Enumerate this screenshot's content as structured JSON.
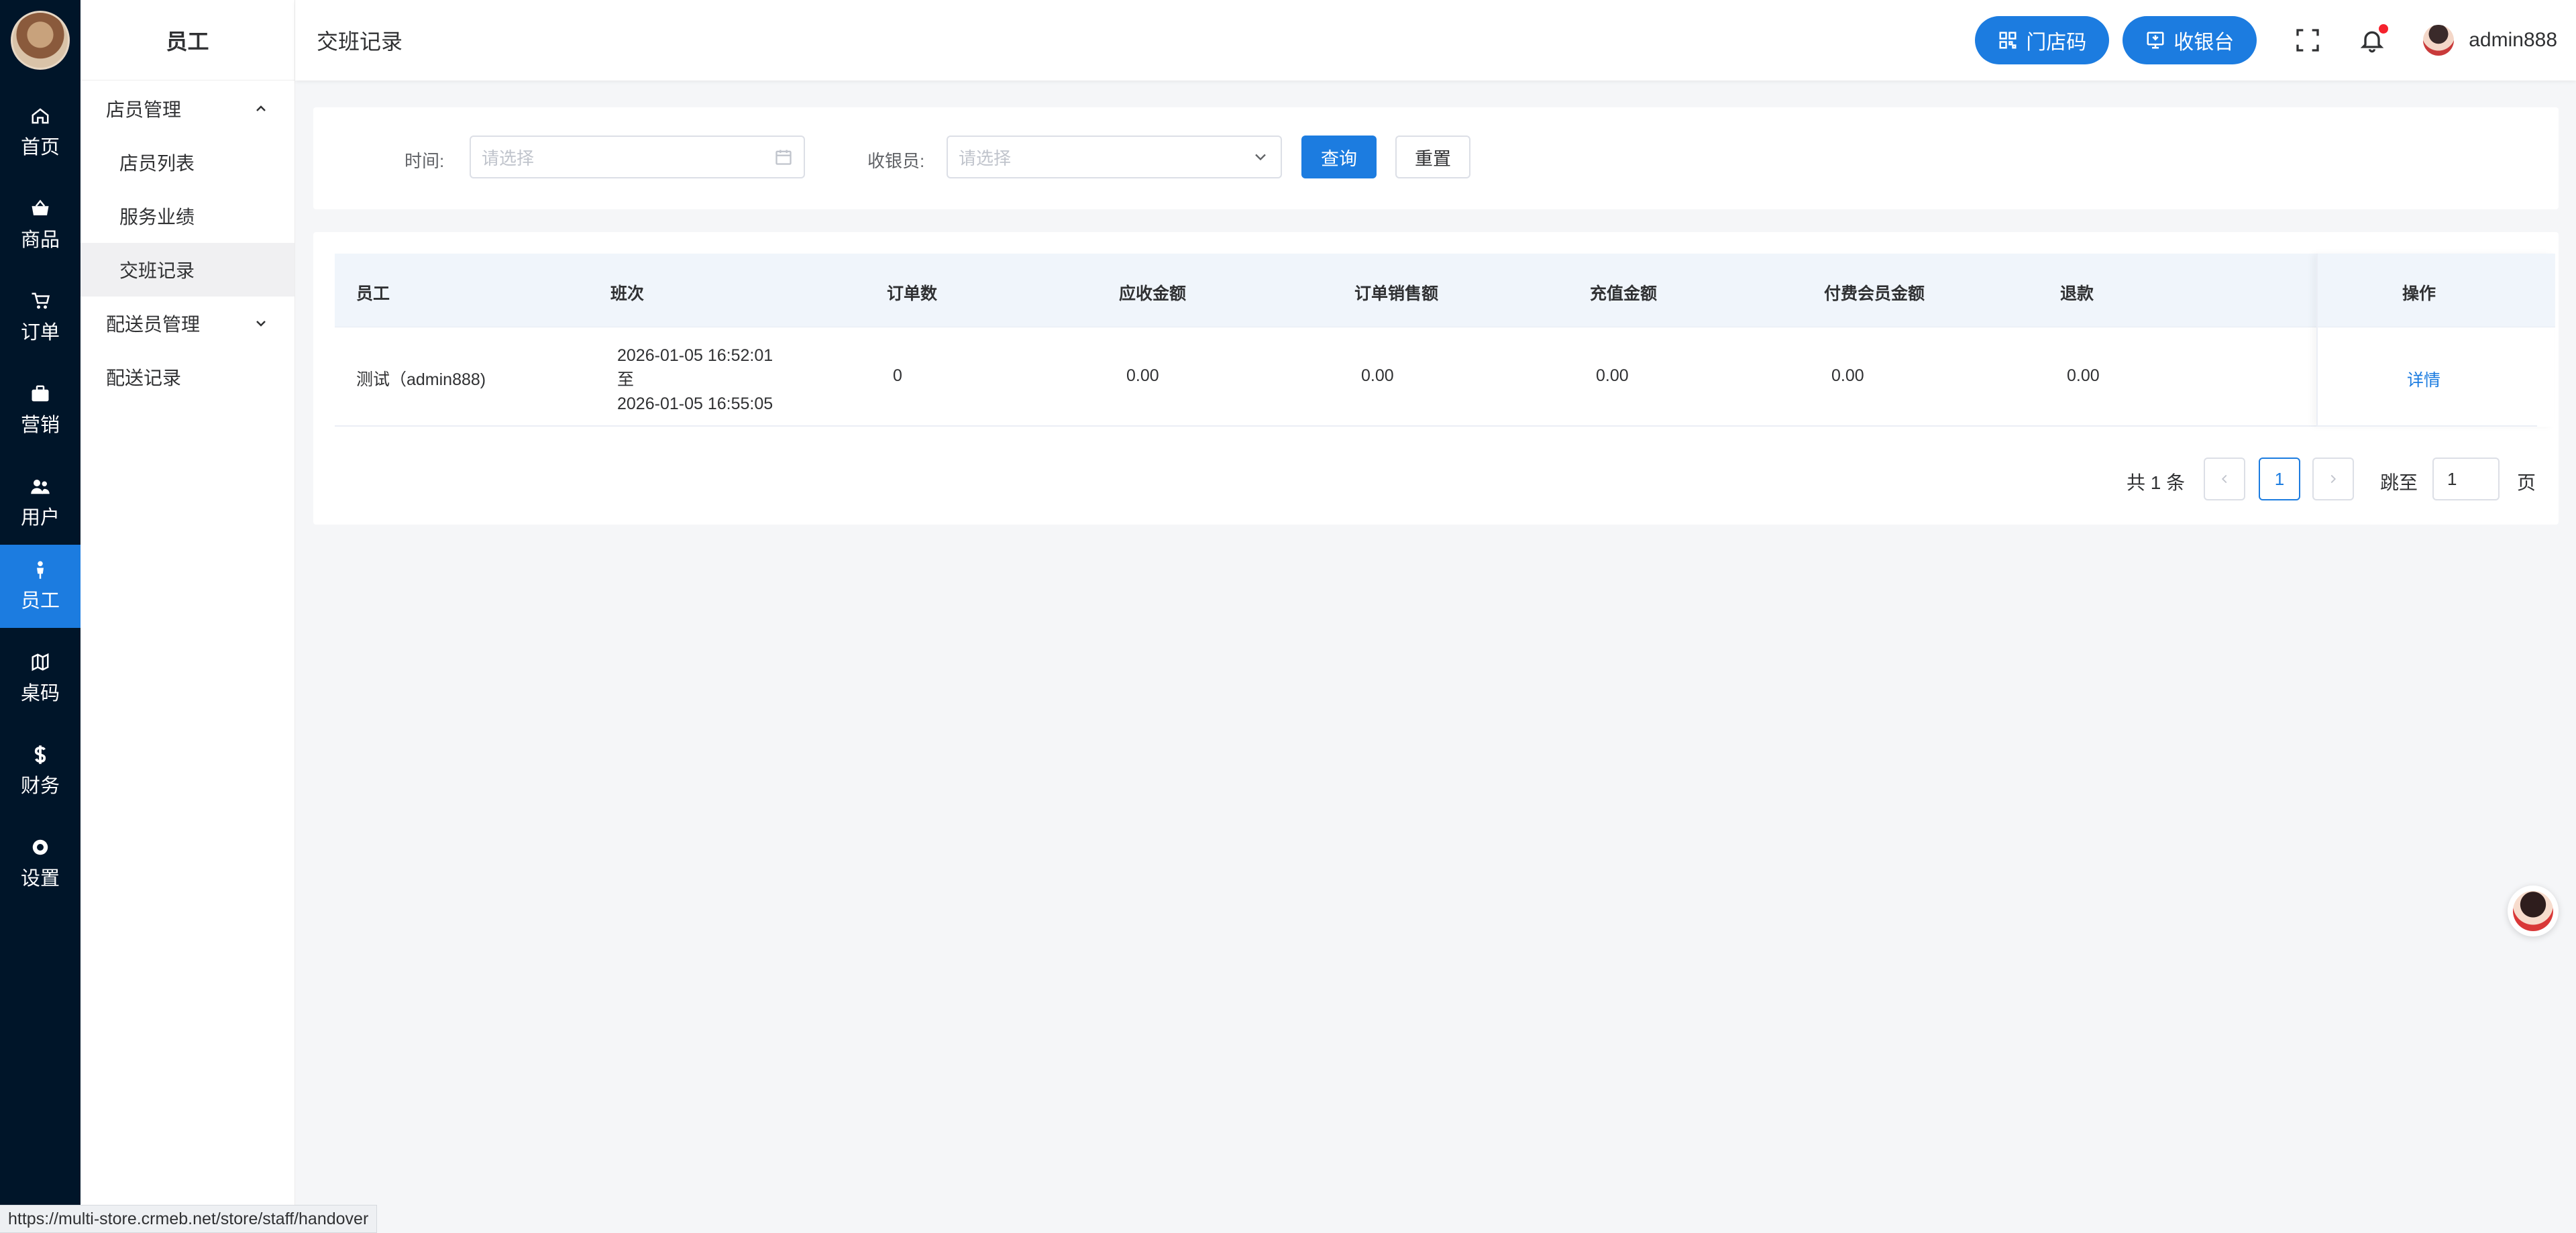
{
  "rail": {
    "items": [
      {
        "label": "首页",
        "icon": "home-icon"
      },
      {
        "label": "商品",
        "icon": "basket-icon"
      },
      {
        "label": "订单",
        "icon": "cart-icon"
      },
      {
        "label": "营销",
        "icon": "briefcase-icon"
      },
      {
        "label": "用户",
        "icon": "users-icon"
      },
      {
        "label": "员工",
        "icon": "person-icon"
      },
      {
        "label": "桌码",
        "icon": "map-icon"
      },
      {
        "label": "财务",
        "icon": "dollar-icon"
      },
      {
        "label": "设置",
        "icon": "settings-icon"
      }
    ],
    "active": "员工"
  },
  "sidebar": {
    "title": "员工",
    "group1": "店员管理",
    "items": [
      "店员列表",
      "服务业绩",
      "交班记录"
    ],
    "active_item": "交班记录",
    "group2": "配送员管理",
    "item_delivery_records": "配送记录"
  },
  "header": {
    "page_title": "交班记录",
    "store_code_label": "门店码",
    "cashier_label": "收银台",
    "username": "admin888"
  },
  "filter": {
    "time_label": "时间:",
    "time_placeholder": "请选择",
    "cashier_label": "收银员:",
    "cashier_placeholder": "请选择",
    "query_label": "查询",
    "reset_label": "重置"
  },
  "table": {
    "columns": [
      "员工",
      "班次",
      "订单数",
      "应收金额",
      "订单销售额",
      "充值金额",
      "付费会员金额",
      "退款",
      "操作"
    ],
    "rows": [
      {
        "staff": "测试（admin888)",
        "shift_start": "2026-01-05 16:52:01",
        "shift_to": "至",
        "shift_end": "2026-01-05 16:55:05",
        "orders": "0",
        "receivable": "0.00",
        "sales": "0.00",
        "recharge": "0.00",
        "member": "0.00",
        "refund": "0.00",
        "action": "详情"
      }
    ]
  },
  "pagination": {
    "total": "共 1 条",
    "current": "1",
    "jump_label": "跳至",
    "jump_value": "1",
    "unit": "页"
  },
  "status_url": "https://multi-store.crmeb.net/store/staff/handover",
  "colors": {
    "accent": "#1c7ce0",
    "rail_bg": "#001529",
    "notify_dot": "#f5222d"
  }
}
